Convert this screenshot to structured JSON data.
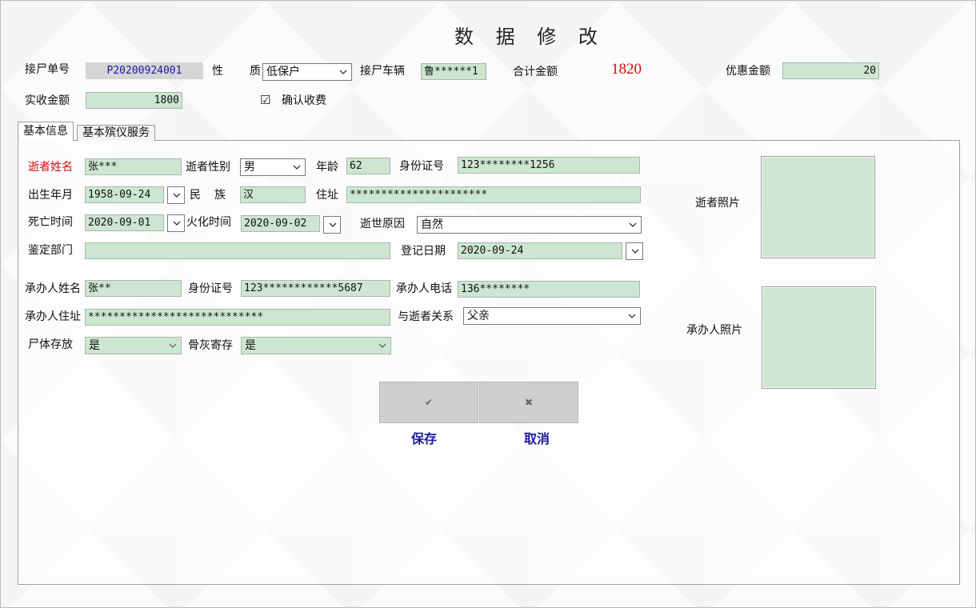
{
  "window": {
    "title": "数 据 修 改"
  },
  "header": {
    "receipt_no_label": "接尸单号",
    "receipt_no_value": "P20200924001",
    "nature_label_1": "性",
    "nature_label_2": "质",
    "nature_value": "低保户",
    "vehicle_label": "接尸车辆",
    "vehicle_value": "鲁******1",
    "total_label": "合计金额",
    "total_value": "1820",
    "discount_label": "优惠金额",
    "discount_value": "20",
    "received_label": "实收金额",
    "received_value": "1800",
    "confirm_label": "确认收费",
    "confirm_checked": "☑"
  },
  "tabs": [
    {
      "label": "基本信息",
      "active": true
    },
    {
      "label": "基本殡仪服务",
      "active": false
    }
  ],
  "form": {
    "deceased_name_label": "逝者姓名",
    "deceased_name_value": "张***",
    "deceased_gender_label": "逝者性别",
    "deceased_gender_value": "男",
    "age_label": "年龄",
    "age_value": "62",
    "id_label": "身份证号",
    "id_value": "123********1256",
    "birth_label": "出生年月",
    "birth_value": "1958-09-24",
    "ethnic_label_1": "民",
    "ethnic_label_2": "族",
    "ethnic_value": "汉",
    "address_label": "住址",
    "address_value": "**********************",
    "death_label": "死亡时间",
    "death_value": "2020-09-01",
    "cremation_label": "火化时间",
    "cremation_value": "2020-09-02",
    "cause_label": "逝世原因",
    "cause_value": "自然",
    "dept_label": "鉴定部门",
    "dept_value": "",
    "reg_date_label": "登记日期",
    "reg_date_value": "2020-09-24",
    "agent_name_label": "承办人姓名",
    "agent_name_value": "张**",
    "agent_id_label": "身份证号",
    "agent_id_value": "123************5687",
    "agent_phone_label": "承办人电话",
    "agent_phone_value": "136********",
    "agent_address_label": "承办人住址",
    "agent_address_value": "****************************",
    "relation_label": "与逝者关系",
    "relation_value": "父亲",
    "body_storage_label": "尸体存放",
    "body_storage_value": "是",
    "ash_storage_label": "骨灰寄存",
    "ash_storage_value": "是",
    "deceased_photo_label": "逝者照片",
    "agent_photo_label": "承办人照片"
  },
  "buttons": {
    "save_label": "保存",
    "cancel_label": "取消",
    "save_glyph": "✔",
    "cancel_glyph": "✖"
  },
  "colors": {
    "field_bg": "#cde6d2",
    "required_label": "#d21010",
    "total_value": "#d21010",
    "button_label": "#1a1aa0"
  }
}
